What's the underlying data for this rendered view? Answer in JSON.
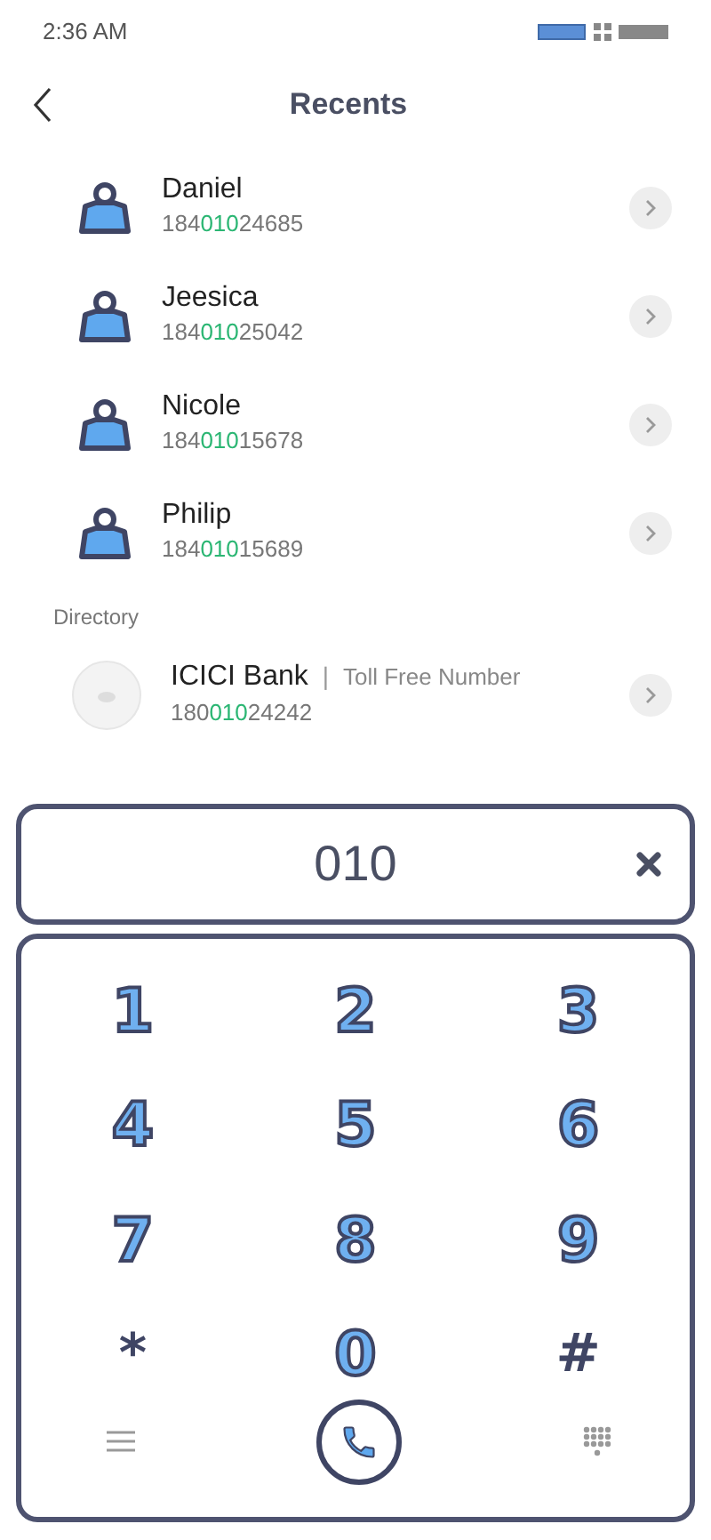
{
  "status_bar": {
    "time": "2:36 AM"
  },
  "header": {
    "title": "Recents"
  },
  "recents": [
    {
      "name": "Daniel",
      "number": {
        "before": "184",
        "match": "010",
        "after": "24685"
      }
    },
    {
      "name": "Jeesica",
      "number": {
        "before": "184",
        "match": "010",
        "after": "25042"
      }
    },
    {
      "name": "Nicole",
      "number": {
        "before": "184",
        "match": "010",
        "after": "15678"
      }
    },
    {
      "name": "Philip",
      "number": {
        "before": "184",
        "match": "010",
        "after": "15689"
      }
    }
  ],
  "directory": {
    "heading": "Directory",
    "items": [
      {
        "name": "ICICI Bank",
        "separator": "|",
        "tag": "Toll Free Number",
        "number": {
          "before": "180",
          "match": "010",
          "after": "24242"
        }
      }
    ]
  },
  "dialer": {
    "input": "010",
    "keys": [
      "1",
      "2",
      "3",
      "4",
      "5",
      "6",
      "7",
      "8",
      "9",
      "*",
      "0",
      "#"
    ]
  }
}
